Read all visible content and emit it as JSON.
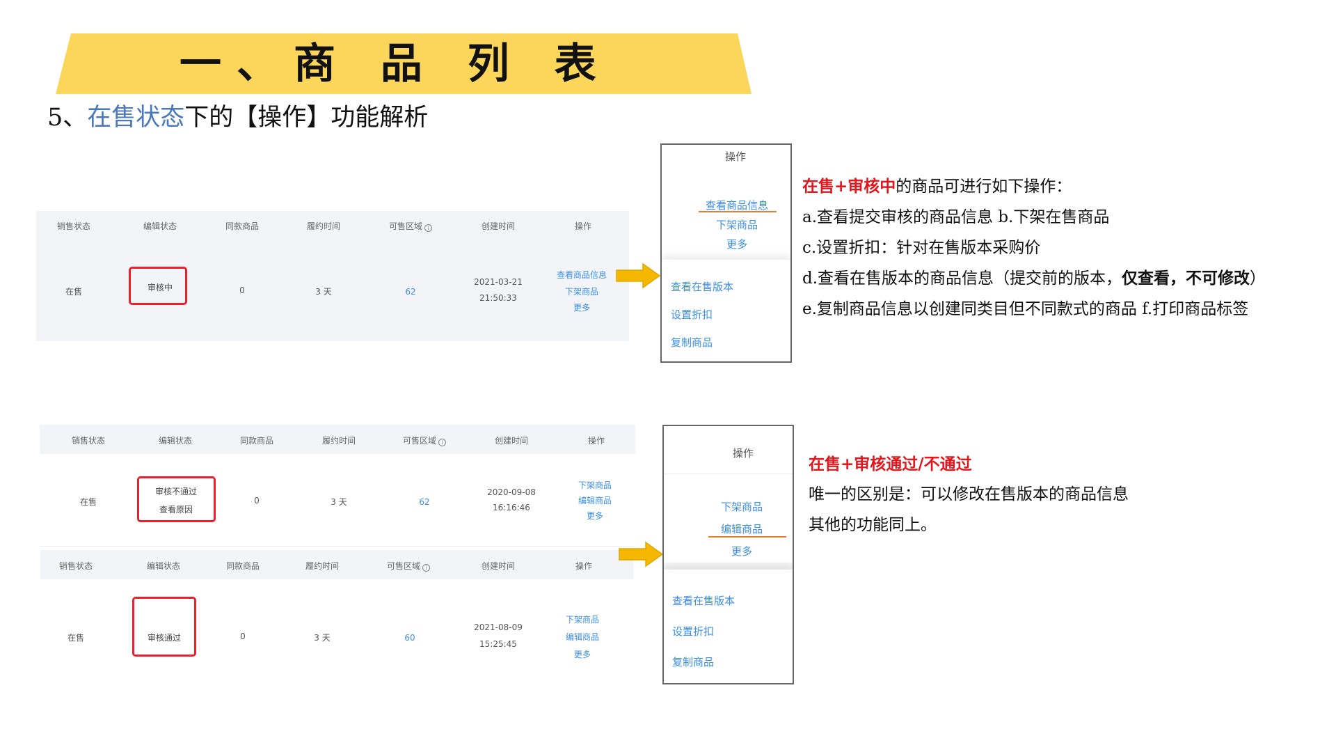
{
  "banner": {
    "title": "一、商 品 列 表",
    "color": "#fbd65a"
  },
  "subtitle": {
    "prefix": "5、",
    "highlight": "在售状态",
    "suffix": "下的【操作】功能解析"
  },
  "table_headers": {
    "sale_status": "销售状态",
    "edit_status": "编辑状态",
    "same_goods": "同款商品",
    "fulfill_time": "履约时间",
    "region": "可售区域",
    "created": "创建时间",
    "action": "操作"
  },
  "table1": {
    "sale_status": "在售",
    "edit_status": "审核中",
    "same_goods": "0",
    "fulfill_time": "3 天",
    "region": "62",
    "created_date": "2021-03-21",
    "created_time": "21:50:33",
    "actions": [
      "查看商品信息",
      "下架商品",
      "更多"
    ]
  },
  "table2": {
    "sale_status": "在售",
    "edit_status": "审核不通过",
    "edit_link": "查看原因",
    "same_goods": "0",
    "fulfill_time": "3 天",
    "region": "62",
    "created_date": "2020-09-08",
    "created_time": "16:16:46",
    "actions": [
      "下架商品",
      "编辑商品",
      "更多"
    ]
  },
  "table3": {
    "sale_status": "在售",
    "edit_status": "审核通过",
    "same_goods": "0",
    "fulfill_time": "3 天",
    "region": "60",
    "created_date": "2021-08-09",
    "created_time": "15:25:45",
    "actions": [
      "下架商品",
      "编辑商品",
      "更多"
    ]
  },
  "panel1": {
    "header": "操作",
    "top_items": [
      "查看商品信息",
      "下架商品",
      "更多"
    ],
    "menu_items": [
      "查看在售版本",
      "设置折扣",
      "复制商品"
    ]
  },
  "panel2": {
    "header": "操作",
    "top_items": [
      "下架商品",
      "编辑商品",
      "更多"
    ],
    "menu_items": [
      "查看在售版本",
      "设置折扣",
      "复制商品"
    ]
  },
  "annotation1": {
    "title_red": "在售+审核中",
    "title_rest": "的商品可进行如下操作：",
    "line_a": "a.查看提交审核的商品信息 b.下架在售商品",
    "line_c": "c.设置折扣：针对在售版本采购价",
    "line_d_pre": "d.查看在售版本的商品信息（提交前的版本，",
    "line_d_bold": "仅查看，不可修改",
    "line_d_post": "）",
    "line_e": "e.复制商品信息以创建同类目但不同款式的商品  f.打印商品标签"
  },
  "annotation2": {
    "title_red": "在售+审核通过/不通过",
    "line_1": "唯一的区别是：可以修改在售版本的商品信息",
    "line_2": "其他的功能同上。"
  },
  "colors": {
    "link": "#3b8ee8",
    "highlight_red": "#e3161c",
    "box_red": "#e8212d",
    "arrow": "#f5b800",
    "subtitle_blue": "#4a78b8",
    "underline": "#f07b2a"
  }
}
